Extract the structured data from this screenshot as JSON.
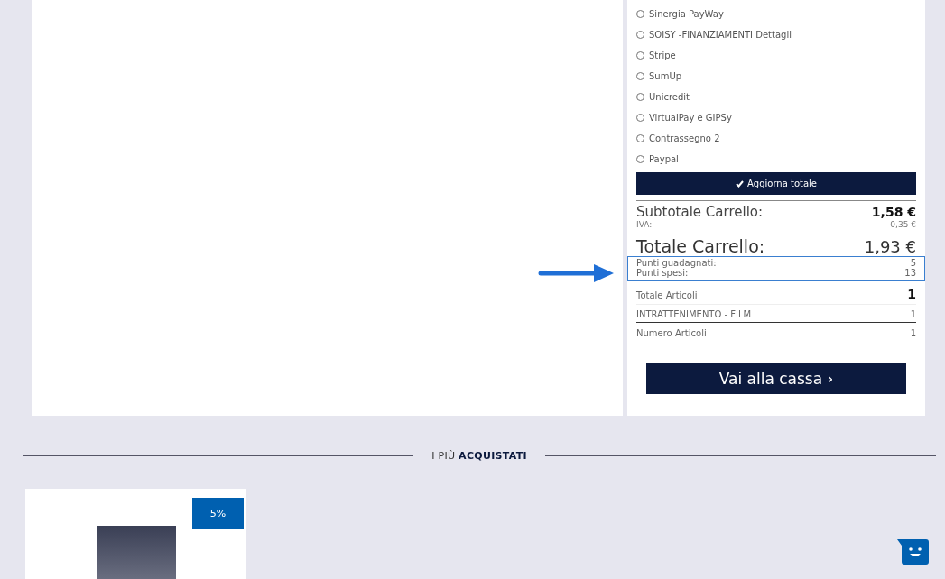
{
  "payment_methods": [
    {
      "label": "Sinergia PayWay",
      "selected": false
    },
    {
      "label": "SOISY -FINANZIAMENTI Dettagli",
      "selected": false
    },
    {
      "label": "Stripe",
      "selected": false
    },
    {
      "label": "SumUp",
      "selected": false
    },
    {
      "label": "Unicredit",
      "selected": false
    },
    {
      "label": "VirtualPay e GIPSy",
      "selected": false
    },
    {
      "label": "Contrassegno 2",
      "selected": false
    },
    {
      "label": "Paypal",
      "selected": false
    }
  ],
  "update_button": "Aggiorna totale",
  "subtotal": {
    "label": "Subtotale Carrello:",
    "value": "1,58 €"
  },
  "vat": {
    "label": "IVA:",
    "value": "0,35 €"
  },
  "total": {
    "label": "Totale Carrello:",
    "value": "1,93 €"
  },
  "points": [
    {
      "label": "Punti guadagnati:",
      "value": "5"
    },
    {
      "label": "Punti spesi:",
      "value": "13"
    }
  ],
  "points_highlighted": true,
  "totale_articoli": {
    "label": "Totale Articoli",
    "value": "1"
  },
  "categories": [
    {
      "label": "INTRATTENIMENTO - FILM",
      "value": "1"
    }
  ],
  "numero_articoli": {
    "label": "Numero Articoli",
    "value": "1"
  },
  "checkout_button": "Vai alla cassa ›",
  "section_title": "I PIÙ **ACQUISTATI**",
  "products": [
    {
      "badge": "5%"
    }
  ]
}
